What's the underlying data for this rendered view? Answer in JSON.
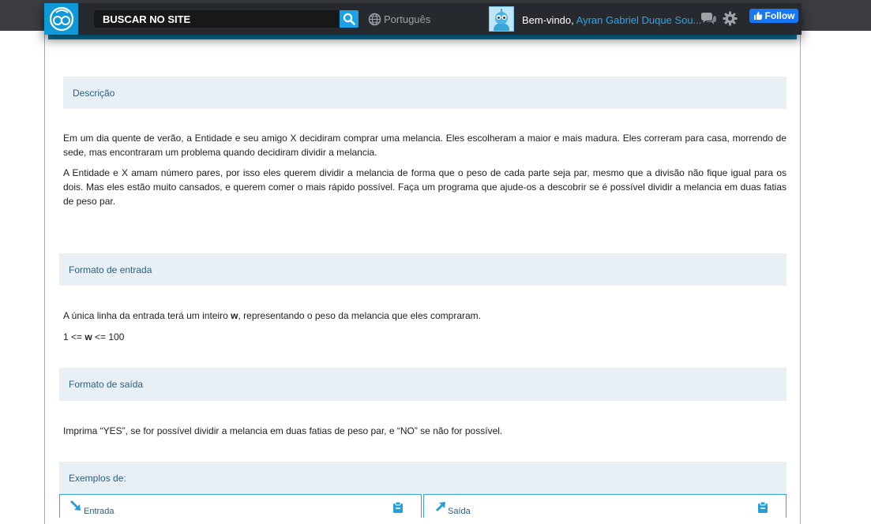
{
  "header": {
    "search_placeholder": "BUSCAR NO SITE",
    "language": "Português",
    "welcome_prefix": "Bem-vindo,",
    "user_name": "Ayran Gabriel Duque Sou...",
    "follow_label": "Follow",
    "accent_color": "#0e98d9"
  },
  "icons": [
    "logo-icon",
    "search-icon",
    "globe-icon",
    "avatar",
    "chat-icon",
    "gear-icon",
    "thumbs-up-icon",
    "arrow-icon",
    "clipboard-icon"
  ],
  "description": {
    "heading": "Descrição",
    "paragraph1": "Em um dia quente de verão, a Entidade e seu amigo X decidiram comprar uma melancia. Eles escolheram a maior e mais madura. Eles correram para casa, morrendo de sede, mas encontraram um problema quando decidiram dividir a melancia.",
    "paragraph2": "A Entidade e X amam número pares, por isso eles querem dividir a melancia de forma que o peso de cada parte seja par, mesmo que a divisão não fique igual para os dois. Mas eles estão muito cansados, e querem comer o mais rápido possível. Faça um programa que ajude-os a descobrir se é possível dividir a melancia em duas fatias de peso par."
  },
  "input_format": {
    "heading": "Formato de entrada",
    "line_before": "A única linha da entrada terá um inteiro ",
    "var": "w",
    "line_after": ", representando o peso da melancia que eles compraram.",
    "constraint_before": "1 <= ",
    "constraint_var": "w",
    "constraint_after": " <= 100"
  },
  "output_format": {
    "heading": "Formato de saída",
    "paragraph": "Imprima “YES”, se for possível dividir a melancia em duas fatias de peso par, e “NO” se não for possível."
  },
  "examples": {
    "heading": "Exemplos de:",
    "input_label": "Entrada",
    "output_label": "Saída"
  }
}
